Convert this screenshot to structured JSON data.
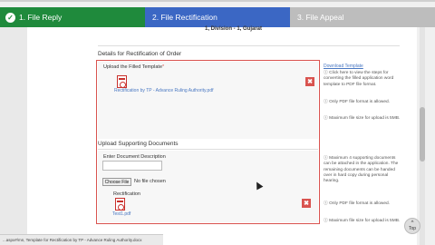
{
  "steps": [
    {
      "label": "1. File Reply",
      "state": "done",
      "color": "#1f8a3c"
    },
    {
      "label": "2. File Rectification",
      "state": "active",
      "color": "#3b67c4"
    },
    {
      "label": "3. File Appeal",
      "state": "pending",
      "color": "#bdbdbd"
    }
  ],
  "clipped_text": "1, Division - 1, Gujarat",
  "section_title": "Details for Rectification of Order",
  "upload_template": {
    "label": "Upload the Filled Template",
    "required_mark": "*",
    "file_name": "Rectification by TP - Advance Ruling Authority.pdf"
  },
  "supporting": {
    "title": "Upload Supporting Documents",
    "desc_label": "Enter Document Description",
    "choose_button": "Choose File",
    "no_file_text": "No file chosen",
    "doc_label": "Rectification",
    "doc_file": "Test1.pdf"
  },
  "help_top": {
    "link": "Download Template",
    "note1": "Click here to view the steps for converting the filled application word template to PDF file format.",
    "note2": "Only PDF file format is allowed.",
    "note3": "Maximum file size for upload is 5MB."
  },
  "help_bottom": {
    "note1": "Maximum 4 supporting documents can be attached in the application. The remaining documents can be handed over in hard copy during personal hearing.",
    "note2": "Only PDF file format is allowed.",
    "note3": "Maximum file size for upload is 5MB."
  },
  "status_bar_text": "...aspx#/mn, Template for Rectification by TP - Advance Ruling Authority.docx",
  "top_button": "Top",
  "delete_glyph": "✖",
  "check_glyph": "✓",
  "arrow_glyph": "^"
}
